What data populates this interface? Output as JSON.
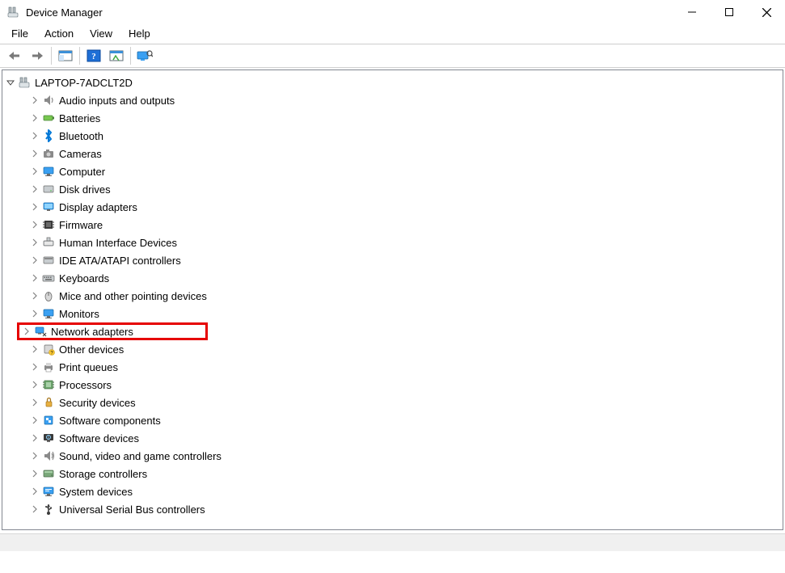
{
  "window": {
    "title": "Device Manager"
  },
  "menu": {
    "items": [
      "File",
      "Action",
      "View",
      "Help"
    ]
  },
  "tree": {
    "root": {
      "label": "LAPTOP-7ADCLT2D",
      "expanded": true
    },
    "children": [
      {
        "id": "audio",
        "label": "Audio inputs and outputs",
        "icon": "speaker-icon"
      },
      {
        "id": "batteries",
        "label": "Batteries",
        "icon": "battery-icon"
      },
      {
        "id": "bluetooth",
        "label": "Bluetooth",
        "icon": "bluetooth-icon"
      },
      {
        "id": "cameras",
        "label": "Cameras",
        "icon": "camera-icon"
      },
      {
        "id": "computer",
        "label": "Computer",
        "icon": "computer-icon"
      },
      {
        "id": "diskdrives",
        "label": "Disk drives",
        "icon": "disk-icon"
      },
      {
        "id": "display",
        "label": "Display adapters",
        "icon": "display-icon"
      },
      {
        "id": "firmware",
        "label": "Firmware",
        "icon": "firmware-icon"
      },
      {
        "id": "hid",
        "label": "Human Interface Devices",
        "icon": "hid-icon"
      },
      {
        "id": "ide",
        "label": "IDE ATA/ATAPI controllers",
        "icon": "ide-icon"
      },
      {
        "id": "keyboards",
        "label": "Keyboards",
        "icon": "keyboard-icon"
      },
      {
        "id": "mice",
        "label": "Mice and other pointing devices",
        "icon": "mouse-icon"
      },
      {
        "id": "monitors",
        "label": "Monitors",
        "icon": "monitor-icon"
      },
      {
        "id": "network",
        "label": "Network adapters",
        "icon": "network-icon",
        "highlighted": true
      },
      {
        "id": "other",
        "label": "Other devices",
        "icon": "other-icon"
      },
      {
        "id": "printq",
        "label": "Print queues",
        "icon": "printer-icon"
      },
      {
        "id": "processors",
        "label": "Processors",
        "icon": "cpu-icon"
      },
      {
        "id": "security",
        "label": "Security devices",
        "icon": "security-icon"
      },
      {
        "id": "swcomp",
        "label": "Software components",
        "icon": "swcomp-icon"
      },
      {
        "id": "swdev",
        "label": "Software devices",
        "icon": "swdev-icon"
      },
      {
        "id": "sound",
        "label": "Sound, video and game controllers",
        "icon": "sound-icon"
      },
      {
        "id": "storage",
        "label": "Storage controllers",
        "icon": "storage-icon"
      },
      {
        "id": "system",
        "label": "System devices",
        "icon": "system-icon"
      },
      {
        "id": "usb",
        "label": "Universal Serial Bus controllers",
        "icon": "usb-icon"
      }
    ]
  }
}
